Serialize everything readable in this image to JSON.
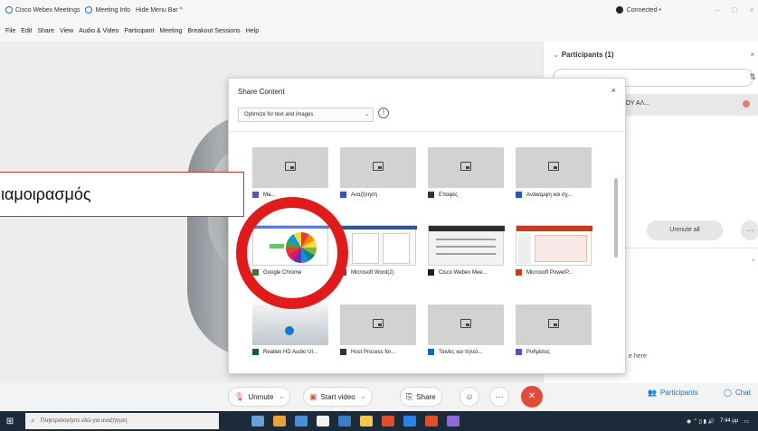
{
  "titlebar": {
    "app_name": "Cisco Webex Meetings",
    "meeting_info": "Meeting Info",
    "hide_menu": "Hide Menu Bar ^",
    "connection": "Connected •",
    "win_controls": [
      "–",
      "□",
      "×"
    ]
  },
  "menubar": {
    "items": [
      "File",
      "Edit",
      "Share",
      "View",
      "Audio & Video",
      "Participant",
      "Meeting",
      "Breakout Sessions",
      "Help"
    ]
  },
  "participants": {
    "header": "Participants (1)",
    "search_extra": "⇅",
    "row_name": "ΥΛΟΥ ΑΛ...",
    "unmute_all": "Unmute all",
    "more": "···",
    "footer_text": "e here"
  },
  "dialog": {
    "title": "Share Content",
    "close": "×",
    "optimize_value": "Optimize for text and images",
    "info": "!",
    "tiles_row1": [
      {
        "label": "Ma...",
        "app_color": "#5b4fc4"
      },
      {
        "label": "Αναζήτηση",
        "app_color": "#3d4ec4"
      },
      {
        "label": "Επαφές",
        "app_color": "#333333"
      },
      {
        "label": "Ανάκαμψη και σχ...",
        "app_color": "#1e5aa8"
      }
    ],
    "tiles_row2": [
      {
        "label": "Google Chrome",
        "app_color": "#2e7d32"
      },
      {
        "label": "Microsoft Word(2)",
        "app_color": "#2b579a"
      },
      {
        "label": "Cisco Webex Mee...",
        "app_color": "#1f1f1f"
      },
      {
        "label": "Microsoft PowerP...",
        "app_color": "#c43e1c"
      }
    ],
    "tiles_row3": [
      {
        "label": "Realtek HD Audio UI...",
        "app_color": "#0d5e3a"
      },
      {
        "label": "Host Process for...",
        "app_color": "#333333"
      },
      {
        "label": "Ταινίες και τηλεό...",
        "app_color": "#1565c0"
      },
      {
        "label": "Ρυθμίσεις",
        "app_color": "#5b4fc4"
      }
    ]
  },
  "callout": {
    "text": "ιαμοιρασμός"
  },
  "controls": {
    "unmute": "Unmute",
    "start_video": "Start video",
    "share": "Share",
    "emoji": "☺",
    "more": "···",
    "end": "✕",
    "participants": "Participants",
    "chat": "Chat"
  },
  "taskbar": {
    "search_placeholder": "Πληκτρολογήστε εδώ για αναζήτηση",
    "time": "7:44 μμ",
    "app_colors": [
      "#6aa0d8",
      "#e8a33b",
      "#4a90d9",
      "#f2f2f2",
      "#3d7cc9",
      "#f2c94c",
      "#e24e2b",
      "#2f80ed",
      "#e24e2b",
      "#8c6ad8"
    ]
  }
}
